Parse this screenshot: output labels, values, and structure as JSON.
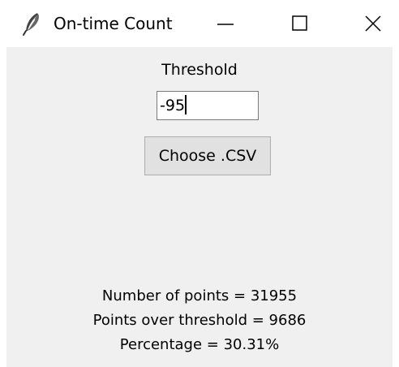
{
  "window": {
    "title": "On-time Count",
    "icon": "feather-icon",
    "controls": {
      "minimize": "minimize-icon",
      "maximize": "maximize-icon",
      "close": "close-icon"
    }
  },
  "form": {
    "threshold_label": "Threshold",
    "threshold_value": "-95",
    "choose_button_label": "Choose .CSV"
  },
  "results": {
    "number_of_points": "Number of points = 31955",
    "points_over_threshold": "Points over threshold = 9686",
    "percentage": "Percentage = 30.31%"
  },
  "colors": {
    "client_background": "#f0f0f0",
    "titlebar_background": "#ffffff",
    "button_background": "#e1e1e1"
  }
}
